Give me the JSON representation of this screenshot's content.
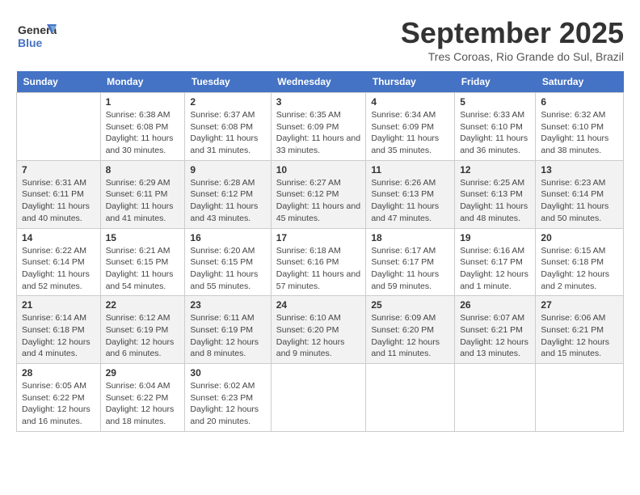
{
  "header": {
    "logo_general": "General",
    "logo_blue": "Blue",
    "month_title": "September 2025",
    "subtitle": "Tres Coroas, Rio Grande do Sul, Brazil"
  },
  "weekdays": [
    "Sunday",
    "Monday",
    "Tuesday",
    "Wednesday",
    "Thursday",
    "Friday",
    "Saturday"
  ],
  "weeks": [
    [
      {
        "day": "",
        "sunrise": "",
        "sunset": "",
        "daylight": ""
      },
      {
        "day": "1",
        "sunrise": "Sunrise: 6:38 AM",
        "sunset": "Sunset: 6:08 PM",
        "daylight": "Daylight: 11 hours and 30 minutes."
      },
      {
        "day": "2",
        "sunrise": "Sunrise: 6:37 AM",
        "sunset": "Sunset: 6:08 PM",
        "daylight": "Daylight: 11 hours and 31 minutes."
      },
      {
        "day": "3",
        "sunrise": "Sunrise: 6:35 AM",
        "sunset": "Sunset: 6:09 PM",
        "daylight": "Daylight: 11 hours and 33 minutes."
      },
      {
        "day": "4",
        "sunrise": "Sunrise: 6:34 AM",
        "sunset": "Sunset: 6:09 PM",
        "daylight": "Daylight: 11 hours and 35 minutes."
      },
      {
        "day": "5",
        "sunrise": "Sunrise: 6:33 AM",
        "sunset": "Sunset: 6:10 PM",
        "daylight": "Daylight: 11 hours and 36 minutes."
      },
      {
        "day": "6",
        "sunrise": "Sunrise: 6:32 AM",
        "sunset": "Sunset: 6:10 PM",
        "daylight": "Daylight: 11 hours and 38 minutes."
      }
    ],
    [
      {
        "day": "7",
        "sunrise": "Sunrise: 6:31 AM",
        "sunset": "Sunset: 6:11 PM",
        "daylight": "Daylight: 11 hours and 40 minutes."
      },
      {
        "day": "8",
        "sunrise": "Sunrise: 6:29 AM",
        "sunset": "Sunset: 6:11 PM",
        "daylight": "Daylight: 11 hours and 41 minutes."
      },
      {
        "day": "9",
        "sunrise": "Sunrise: 6:28 AM",
        "sunset": "Sunset: 6:12 PM",
        "daylight": "Daylight: 11 hours and 43 minutes."
      },
      {
        "day": "10",
        "sunrise": "Sunrise: 6:27 AM",
        "sunset": "Sunset: 6:12 PM",
        "daylight": "Daylight: 11 hours and 45 minutes."
      },
      {
        "day": "11",
        "sunrise": "Sunrise: 6:26 AM",
        "sunset": "Sunset: 6:13 PM",
        "daylight": "Daylight: 11 hours and 47 minutes."
      },
      {
        "day": "12",
        "sunrise": "Sunrise: 6:25 AM",
        "sunset": "Sunset: 6:13 PM",
        "daylight": "Daylight: 11 hours and 48 minutes."
      },
      {
        "day": "13",
        "sunrise": "Sunrise: 6:23 AM",
        "sunset": "Sunset: 6:14 PM",
        "daylight": "Daylight: 11 hours and 50 minutes."
      }
    ],
    [
      {
        "day": "14",
        "sunrise": "Sunrise: 6:22 AM",
        "sunset": "Sunset: 6:14 PM",
        "daylight": "Daylight: 11 hours and 52 minutes."
      },
      {
        "day": "15",
        "sunrise": "Sunrise: 6:21 AM",
        "sunset": "Sunset: 6:15 PM",
        "daylight": "Daylight: 11 hours and 54 minutes."
      },
      {
        "day": "16",
        "sunrise": "Sunrise: 6:20 AM",
        "sunset": "Sunset: 6:15 PM",
        "daylight": "Daylight: 11 hours and 55 minutes."
      },
      {
        "day": "17",
        "sunrise": "Sunrise: 6:18 AM",
        "sunset": "Sunset: 6:16 PM",
        "daylight": "Daylight: 11 hours and 57 minutes."
      },
      {
        "day": "18",
        "sunrise": "Sunrise: 6:17 AM",
        "sunset": "Sunset: 6:17 PM",
        "daylight": "Daylight: 11 hours and 59 minutes."
      },
      {
        "day": "19",
        "sunrise": "Sunrise: 6:16 AM",
        "sunset": "Sunset: 6:17 PM",
        "daylight": "Daylight: 12 hours and 1 minute."
      },
      {
        "day": "20",
        "sunrise": "Sunrise: 6:15 AM",
        "sunset": "Sunset: 6:18 PM",
        "daylight": "Daylight: 12 hours and 2 minutes."
      }
    ],
    [
      {
        "day": "21",
        "sunrise": "Sunrise: 6:14 AM",
        "sunset": "Sunset: 6:18 PM",
        "daylight": "Daylight: 12 hours and 4 minutes."
      },
      {
        "day": "22",
        "sunrise": "Sunrise: 6:12 AM",
        "sunset": "Sunset: 6:19 PM",
        "daylight": "Daylight: 12 hours and 6 minutes."
      },
      {
        "day": "23",
        "sunrise": "Sunrise: 6:11 AM",
        "sunset": "Sunset: 6:19 PM",
        "daylight": "Daylight: 12 hours and 8 minutes."
      },
      {
        "day": "24",
        "sunrise": "Sunrise: 6:10 AM",
        "sunset": "Sunset: 6:20 PM",
        "daylight": "Daylight: 12 hours and 9 minutes."
      },
      {
        "day": "25",
        "sunrise": "Sunrise: 6:09 AM",
        "sunset": "Sunset: 6:20 PM",
        "daylight": "Daylight: 12 hours and 11 minutes."
      },
      {
        "day": "26",
        "sunrise": "Sunrise: 6:07 AM",
        "sunset": "Sunset: 6:21 PM",
        "daylight": "Daylight: 12 hours and 13 minutes."
      },
      {
        "day": "27",
        "sunrise": "Sunrise: 6:06 AM",
        "sunset": "Sunset: 6:21 PM",
        "daylight": "Daylight: 12 hours and 15 minutes."
      }
    ],
    [
      {
        "day": "28",
        "sunrise": "Sunrise: 6:05 AM",
        "sunset": "Sunset: 6:22 PM",
        "daylight": "Daylight: 12 hours and 16 minutes."
      },
      {
        "day": "29",
        "sunrise": "Sunrise: 6:04 AM",
        "sunset": "Sunset: 6:22 PM",
        "daylight": "Daylight: 12 hours and 18 minutes."
      },
      {
        "day": "30",
        "sunrise": "Sunrise: 6:02 AM",
        "sunset": "Sunset: 6:23 PM",
        "daylight": "Daylight: 12 hours and 20 minutes."
      },
      {
        "day": "",
        "sunrise": "",
        "sunset": "",
        "daylight": ""
      },
      {
        "day": "",
        "sunrise": "",
        "sunset": "",
        "daylight": ""
      },
      {
        "day": "",
        "sunrise": "",
        "sunset": "",
        "daylight": ""
      },
      {
        "day": "",
        "sunrise": "",
        "sunset": "",
        "daylight": ""
      }
    ]
  ]
}
